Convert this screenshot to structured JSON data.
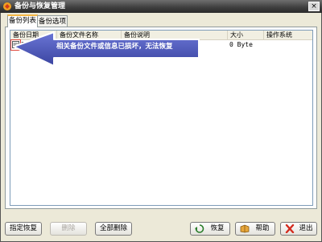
{
  "window": {
    "title": "备份与恢复管理",
    "close_label": "×"
  },
  "tabs": [
    {
      "label": "备份列表",
      "active": true
    },
    {
      "label": "备份选项",
      "active": false
    }
  ],
  "table": {
    "columns": [
      "备份日期",
      "备份文件名称",
      "备份说明",
      "大小",
      "操作系统"
    ],
    "rows": [
      {
        "date": "20",
        "file_name": "",
        "note": "",
        "size": "0 Byte",
        "os": ""
      }
    ]
  },
  "annotation": {
    "text": "相关备份文件或信息已损坏，无法恢复"
  },
  "buttons": {
    "restore_specified": "指定恢复",
    "delete": "删除",
    "delete_all": "全部删除",
    "restore": "恢复",
    "help": "帮助",
    "exit": "退出"
  },
  "colors": {
    "arrow_fill": "#4b56b8",
    "highlight": "#e0463b",
    "accent_tab": "#f5b745"
  }
}
